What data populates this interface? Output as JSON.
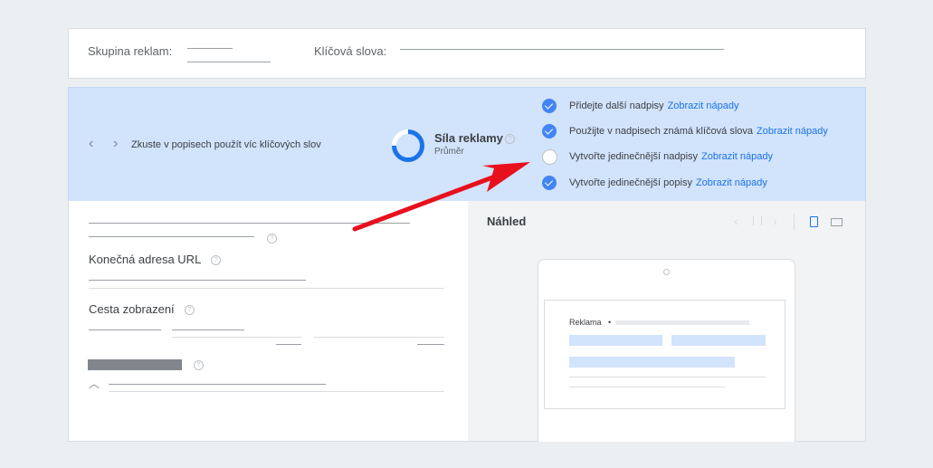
{
  "header": {
    "ad_group_label": "Skupina reklam:",
    "keywords_label": "Klíčová slova:"
  },
  "strength_panel": {
    "tip": "Zkuste v popisech použít víc klíčových slov",
    "strength_title": "Síla reklamy",
    "strength_value": "Průměr",
    "strength_fraction": 0.75,
    "accent_color": "#1a73e8",
    "suggestions": [
      {
        "text": "Přidejte další nadpisy",
        "link": "Zobrazit nápady",
        "done": true
      },
      {
        "text": "Použijte v nadpisech známá klíčová slova",
        "link": "Zobrazit nápady",
        "done": true
      },
      {
        "text": "Vytvořte jedinečnější nadpisy",
        "link": "Zobrazit nápady",
        "done": false
      },
      {
        "text": "Vytvořte jedinečnější popisy",
        "link": "Zobrazit nápady",
        "done": true
      }
    ]
  },
  "form": {
    "final_url_label": "Konečná adresa URL",
    "display_path_label": "Cesta zobrazení"
  },
  "preview": {
    "title": "Náhled",
    "ad_label": "Reklama"
  },
  "annotation": {
    "arrow_color": "#e8101d"
  }
}
